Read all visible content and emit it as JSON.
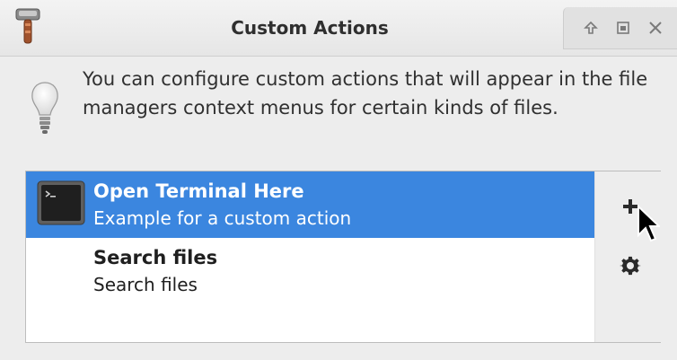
{
  "window": {
    "title": "Custom Actions",
    "controls": {
      "up_icon": "arrow-up-icon",
      "maximize_icon": "maximize-icon",
      "close_icon": "close-icon"
    }
  },
  "info": {
    "text": "You can configure custom actions that will appear in the file managers context menus for certain kinds of files.",
    "icon": "lightbulb-icon"
  },
  "actions": [
    {
      "title": "Open Terminal Here",
      "subtitle": "Example for a custom action",
      "icon": "terminal-icon",
      "selected": true
    },
    {
      "title": "Search files",
      "subtitle": "Search files",
      "icon": "",
      "selected": false
    }
  ],
  "side_buttons": {
    "add_icon": "plus-icon",
    "settings_icon": "gear-icon"
  },
  "colors": {
    "selection": "#3b86df",
    "background": "#ededed"
  }
}
